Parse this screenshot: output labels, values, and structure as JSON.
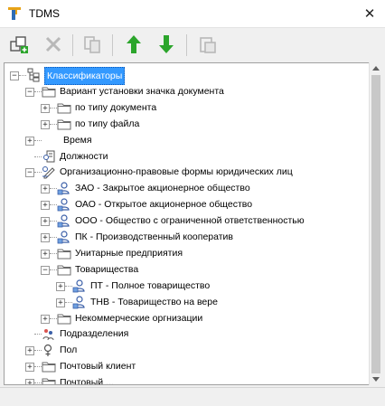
{
  "window": {
    "title": "TDMS",
    "close_glyph": "✕",
    "logo_icon": "tdms-logo-icon"
  },
  "toolbar": {
    "buttons": [
      {
        "name": "add-object-button",
        "icon": "add-object-icon",
        "enabled": true
      },
      {
        "name": "delete-button",
        "icon": "delete-icon",
        "enabled": false
      },
      {
        "name": "copy-button",
        "icon": "copy-icon",
        "enabled": false
      },
      {
        "name": "move-up-button",
        "icon": "arrow-up-icon",
        "enabled": true,
        "color": "#2ca52c"
      },
      {
        "name": "move-down-button",
        "icon": "arrow-down-icon",
        "enabled": true,
        "color": "#2ca52c"
      },
      {
        "name": "paste-button",
        "icon": "paste-icon",
        "enabled": false
      }
    ]
  },
  "tree": {
    "items": [
      {
        "label": "Классификаторы",
        "level": 0,
        "expander": "−",
        "icon": "classifier-root-icon",
        "selected": true
      },
      {
        "label": "Вариант установки значка документа",
        "level": 1,
        "expander": "−",
        "icon": "folder-icon"
      },
      {
        "label": "по типу документа",
        "level": 2,
        "expander": "+",
        "icon": "folder-icon"
      },
      {
        "label": "по типу файла",
        "level": 2,
        "expander": "+",
        "icon": "folder-icon"
      },
      {
        "label": "Время",
        "level": 1,
        "expander": "+",
        "icon": ""
      },
      {
        "label": "Должности",
        "level": 1,
        "expander": "",
        "icon": "positions-icon"
      },
      {
        "label": "Организационно-правовые формы юридических лиц",
        "level": 1,
        "expander": "−",
        "icon": "legal-form-icon"
      },
      {
        "label": "ЗАО - Закрытое акционерное общество",
        "level": 2,
        "expander": "+",
        "icon": "org-icon"
      },
      {
        "label": "ОАО - Открытое акционерное общество",
        "level": 2,
        "expander": "+",
        "icon": "org-icon"
      },
      {
        "label": "ООО - Общество с ограниченной ответственностью",
        "level": 2,
        "expander": "+",
        "icon": "org-icon"
      },
      {
        "label": "ПК - Производственный кооператив",
        "level": 2,
        "expander": "+",
        "icon": "org-icon"
      },
      {
        "label": "Унитарные предприятия",
        "level": 2,
        "expander": "+",
        "icon": "folder-icon"
      },
      {
        "label": "Товарищества",
        "level": 2,
        "expander": "−",
        "icon": "folder-icon"
      },
      {
        "label": "ПТ - Полное товарищество",
        "level": 3,
        "expander": "+",
        "icon": "org-icon"
      },
      {
        "label": "ТНВ - Товарищество на вере",
        "level": 3,
        "expander": "+",
        "icon": "org-icon"
      },
      {
        "label": "Некоммерческие оргнизации",
        "level": 2,
        "expander": "+",
        "icon": "folder-icon"
      },
      {
        "label": "Подразделения",
        "level": 1,
        "expander": "",
        "icon": "departments-icon"
      },
      {
        "label": "Пол",
        "level": 1,
        "expander": "+",
        "icon": "gender-icon"
      },
      {
        "label": "Почтовый клиент",
        "level": 1,
        "expander": "+",
        "icon": "folder-icon"
      },
      {
        "label": "Почтовый ...",
        "level": 1,
        "expander": "+",
        "icon": "folder-icon"
      }
    ]
  }
}
